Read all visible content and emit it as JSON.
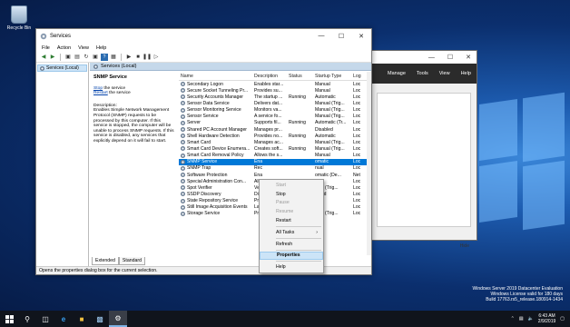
{
  "desktop": {
    "recycle_bin_label": "Recycle Bin",
    "watermark": {
      "line1": "Windows Server 2019 Datacenter Evaluation",
      "line2": "Windows License valid for 180 days",
      "line3": "Build 17763.rs5_release.180914-1434"
    }
  },
  "server_manager": {
    "menu": [
      "Manage",
      "Tools",
      "View",
      "Help"
    ],
    "hide_label": "Hide"
  },
  "services_window": {
    "title": "Services",
    "menu": [
      "File",
      "Action",
      "View",
      "Help"
    ],
    "tree_item": "Services (Local)",
    "header": "Services (Local)",
    "selected_service": "SNMP Service",
    "stop_link": "Stop",
    "stop_rest": " the service",
    "restart_link": "Restart",
    "restart_rest": " the service",
    "description_label": "Description:",
    "description": "Enables Simple Network Management Protocol (SNMP) requests to be processed by this computer. If this service is stopped, the computer will be unable to process SNMP requests. If this service is disabled, any services that explicitly depend on it will fail to start.",
    "columns": [
      "Name",
      "Description",
      "Status",
      "Startup Type",
      "Log"
    ],
    "rows": [
      {
        "name": "Secondary Logon",
        "desc": "Enables star...",
        "status": "",
        "startup": "Manual",
        "log": "Loc"
      },
      {
        "name": "Secure Socket Tunneling Pr...",
        "desc": "Provides su...",
        "status": "",
        "startup": "Manual",
        "log": "Loc"
      },
      {
        "name": "Security Accounts Manager",
        "desc": "The startup ...",
        "status": "Running",
        "startup": "Automatic",
        "log": "Loc"
      },
      {
        "name": "Sensor Data Service",
        "desc": "Delivers dat...",
        "status": "",
        "startup": "Manual (Trig...",
        "log": "Loc"
      },
      {
        "name": "Sensor Monitoring Service",
        "desc": "Monitors va...",
        "status": "",
        "startup": "Manual (Trig...",
        "log": "Loc"
      },
      {
        "name": "Sensor Service",
        "desc": "A service fo...",
        "status": "",
        "startup": "Manual (Trig...",
        "log": "Loc"
      },
      {
        "name": "Server",
        "desc": "Supports fil...",
        "status": "Running",
        "startup": "Automatic (Tr...",
        "log": "Loc"
      },
      {
        "name": "Shared PC Account Manager",
        "desc": "Manages pr...",
        "status": "",
        "startup": "Disabled",
        "log": "Loc"
      },
      {
        "name": "Shell Hardware Detection",
        "desc": "Provides no...",
        "status": "Running",
        "startup": "Automatic",
        "log": "Loc"
      },
      {
        "name": "Smart Card",
        "desc": "Manages ac...",
        "status": "",
        "startup": "Manual (Trig...",
        "log": "Loc"
      },
      {
        "name": "Smart Card Device Enumera...",
        "desc": "Creates soft...",
        "status": "Running",
        "startup": "Manual (Trig...",
        "log": "Loc"
      },
      {
        "name": "Smart Card Removal Policy",
        "desc": "Allows the s...",
        "status": "",
        "startup": "Manual",
        "log": "Loc"
      },
      {
        "name": "SNMP Service",
        "desc": "Ena",
        "status": "",
        "startup": "omatic",
        "log": "Loc",
        "selected": true
      },
      {
        "name": "SNMP Trap",
        "desc": "Rec",
        "status": "",
        "startup": "nual",
        "log": "Loc"
      },
      {
        "name": "Software Protection",
        "desc": "Ena",
        "status": "",
        "startup": "omatic (De...",
        "log": "Net"
      },
      {
        "name": "Special Administration Con...",
        "desc": "Allo",
        "status": "",
        "startup": "nual",
        "log": "Loc"
      },
      {
        "name": "Spot Verifier",
        "desc": "Veri",
        "status": "",
        "startup": "nual (Trig...",
        "log": "Loc"
      },
      {
        "name": "SSDP Discovery",
        "desc": "Disc",
        "status": "",
        "startup": "abled",
        "log": "Loc"
      },
      {
        "name": "State Repository Service",
        "desc": "Prov",
        "status": "",
        "startup": "nual",
        "log": "Loc"
      },
      {
        "name": "Still Image Acquisition Events",
        "desc": "Laun",
        "status": "",
        "startup": "nual",
        "log": "Loc"
      },
      {
        "name": "Storage Service",
        "desc": "Prov",
        "status": "",
        "startup": "nual (Trig...",
        "log": "Loc"
      }
    ],
    "tabs": [
      "Extended",
      "Standard"
    ],
    "status_bar": "Opens the properties dialog box for the current selection."
  },
  "context_menu": {
    "start": "Start",
    "stop": "Stop",
    "pause": "Pause",
    "resume": "Resume",
    "restart": "Restart",
    "all_tasks": "All Tasks",
    "refresh": "Refresh",
    "properties": "Properties",
    "help": "Help"
  },
  "taskbar": {
    "time": "6:43 AM",
    "date": "2/9/2019"
  }
}
